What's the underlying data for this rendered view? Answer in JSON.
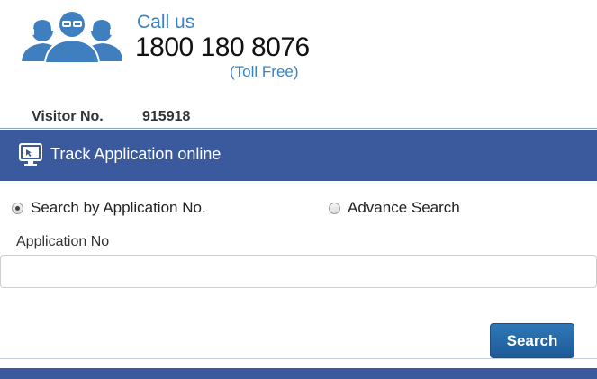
{
  "contact": {
    "call_label": "Call us",
    "phone": "1800 180 8076",
    "toll_free": "(Toll Free)",
    "icon": "customer-support-agents-icon"
  },
  "visitor": {
    "label": "Visitor No.",
    "count": "915918"
  },
  "panel": {
    "title": "Track Application online",
    "icon": "monitor-icon"
  },
  "search_options": [
    {
      "label": "Search by Application No.",
      "selected": true
    },
    {
      "label": "Advance Search",
      "selected": false
    }
  ],
  "form": {
    "field_label": "Application No",
    "field_value": "",
    "placeholder": "",
    "submit_label": "Search"
  },
  "colors": {
    "accent_blue": "#3b82c4",
    "header_bar": "#3b5a9e",
    "button": "#1d5a96"
  }
}
